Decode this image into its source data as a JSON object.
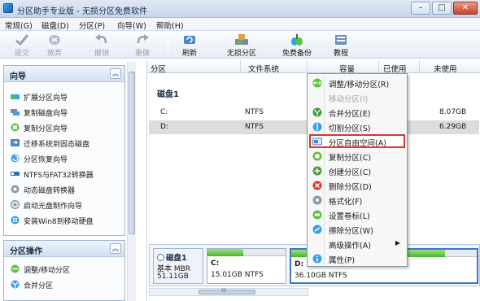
{
  "window": {
    "title": "分区助手专业版 - 无损分区免费软件",
    "controls": {
      "minimize": "–",
      "maximize": "□",
      "close": "✕"
    }
  },
  "menubar": {
    "items": [
      "常规(G)",
      "磁盘(D)",
      "分区(P)",
      "向导(W)",
      "帮助(H)"
    ]
  },
  "toolbar": {
    "buttons": [
      {
        "label": "提交",
        "icon": "commit-check-icon",
        "enabled": false
      },
      {
        "label": "放弃",
        "icon": "discard-icon",
        "enabled": false
      },
      {
        "label": "撤销",
        "icon": "undo-icon",
        "enabled": false
      },
      {
        "label": "重做",
        "icon": "redo-icon",
        "enabled": false
      },
      {
        "label": "刷新",
        "icon": "refresh-icon",
        "enabled": true
      },
      {
        "label": "无损分区",
        "icon": "lossless-partition-icon",
        "enabled": true
      },
      {
        "label": "免费备份",
        "icon": "free-backup-icon",
        "enabled": true
      },
      {
        "label": "教程",
        "icon": "tutorial-icon",
        "enabled": true
      }
    ]
  },
  "sidebar": {
    "wizard_panel": {
      "title": "向导",
      "collapse_glyph": "︽",
      "items": [
        {
          "label": "扩展分区向导",
          "icon": "extend-partition-icon"
        },
        {
          "label": "复制磁盘向导",
          "icon": "copy-disk-icon"
        },
        {
          "label": "复制分区向导",
          "icon": "copy-partition-icon"
        },
        {
          "label": "迁移系统到固态磁盘",
          "icon": "migrate-os-icon"
        },
        {
          "label": "分区恢复向导",
          "icon": "partition-recovery-icon"
        },
        {
          "label": "NTFS与FAT32转换器",
          "icon": "ntfs-fat32-converter-icon"
        },
        {
          "label": "动态磁盘转换器",
          "icon": "dynamic-disk-converter-icon"
        },
        {
          "label": "启动光盘制作向导",
          "icon": "bootable-media-icon"
        },
        {
          "label": "安装Win8到移动硬盘",
          "icon": "win8-to-go-icon"
        }
      ]
    },
    "partition_panel": {
      "title": "分区操作",
      "collapse_glyph": "︽",
      "items": [
        {
          "label": "调整/移动分区",
          "icon": "resize-move-icon"
        },
        {
          "label": "合并分区",
          "icon": "merge-partition-icon"
        }
      ]
    }
  },
  "partition_table": {
    "columns": [
      "分区",
      "文件系统",
      "容量",
      "已使用",
      "未使用"
    ],
    "disk_label": "磁盘1",
    "rows": [
      {
        "partition": "C:",
        "filesystem": "NTFS",
        "unused": "8.07GB",
        "selected": false
      },
      {
        "partition": "D:",
        "filesystem": "NTFS",
        "unused": "6.29GB",
        "selected": true
      }
    ],
    "hscroll_glyph": "III"
  },
  "disk_map": {
    "disk": {
      "name": "磁盘1",
      "type": "基本 MBR",
      "size": "51.11GB"
    },
    "partitions": [
      {
        "name": "C:",
        "detail": "15.01GB NTFS",
        "used_fraction": 0.46,
        "active": false
      },
      {
        "name": "D:",
        "detail": "36.10GB NTFS",
        "used_fraction": 0.83,
        "active": true
      }
    ]
  },
  "context_menu": {
    "items": [
      {
        "label": "调整/移动分区(R)",
        "icon": "resize-move-icon",
        "enabled": true,
        "highlight": false,
        "submenu": false
      },
      {
        "label": "移动分区(I)",
        "icon": "",
        "enabled": false,
        "highlight": false,
        "submenu": false
      },
      {
        "label": "合并分区(E)",
        "icon": "merge-partition-icon",
        "enabled": true,
        "highlight": false,
        "submenu": false
      },
      {
        "label": "切割分区(S)",
        "icon": "split-partition-icon",
        "enabled": true,
        "highlight": false,
        "submenu": false
      },
      {
        "label": "分区自由空间(A)",
        "icon": "allocate-free-space-icon",
        "enabled": true,
        "highlight": true,
        "submenu": false
      },
      {
        "label": "复制分区(C)",
        "icon": "copy-partition-icon",
        "enabled": true,
        "highlight": false,
        "submenu": false
      },
      {
        "label": "创建分区(C)",
        "icon": "create-partition-icon",
        "enabled": true,
        "highlight": false,
        "submenu": false
      },
      {
        "label": "删除分区(D)",
        "icon": "delete-partition-icon",
        "enabled": true,
        "highlight": false,
        "submenu": false
      },
      {
        "label": "格式化(F)",
        "icon": "format-icon",
        "enabled": true,
        "highlight": false,
        "submenu": false
      },
      {
        "label": "设置卷标(L)",
        "icon": "set-label-icon",
        "enabled": true,
        "highlight": false,
        "submenu": false
      },
      {
        "label": "擦除分区(W)",
        "icon": "wipe-partition-icon",
        "enabled": true,
        "highlight": false,
        "submenu": false
      },
      {
        "label": "高级操作(A)",
        "icon": "",
        "enabled": true,
        "highlight": false,
        "submenu": true
      },
      {
        "label": "属性(P)",
        "icon": "properties-icon",
        "enabled": true,
        "highlight": false,
        "submenu": false
      }
    ],
    "submenu_glyph": "▶"
  },
  "colors": {
    "highlight_border": "#d9362d",
    "used_space": "#48b52d",
    "selection": "#dcdcdc",
    "accent": "#3a78c8"
  }
}
